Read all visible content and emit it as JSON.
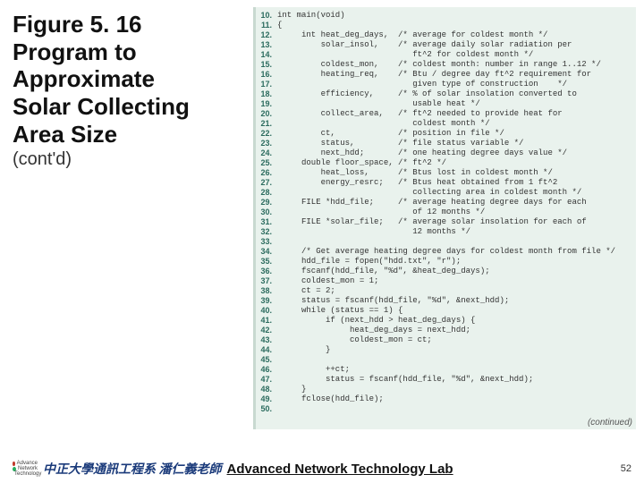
{
  "title": "Figure 5. 16\nProgram to\nApproximate\nSolar Collecting\nArea Size",
  "subtitle": "(cont'd)",
  "continued": "(continued)",
  "footer": {
    "icon_lines": [
      "Advance",
      "Network",
      "Technology"
    ],
    "cn": "中正大學通訊工程系 潘仁義老師",
    "lab": "Advanced Network Technology Lab",
    "page": "52"
  },
  "code": [
    {
      "n": "10.",
      "t": "int main(void)"
    },
    {
      "n": "11.",
      "t": "{"
    },
    {
      "n": "12.",
      "t": "     int heat_deg_days,  /* average for coldest month */"
    },
    {
      "n": "13.",
      "t": "         solar_insol,    /* average daily solar radiation per"
    },
    {
      "n": "14.",
      "t": "                            ft^2 for coldest month */"
    },
    {
      "n": "15.",
      "t": "         coldest_mon,    /* coldest month: number in range 1..12 */"
    },
    {
      "n": "16.",
      "t": "         heating_req,    /* Btu / degree day ft^2 requirement for"
    },
    {
      "n": "17.",
      "t": "                            given type of construction    */"
    },
    {
      "n": "18.",
      "t": "         efficiency,     /* % of solar insolation converted to"
    },
    {
      "n": "19.",
      "t": "                            usable heat */"
    },
    {
      "n": "20.",
      "t": "         collect_area,   /* ft^2 needed to provide heat for"
    },
    {
      "n": "21.",
      "t": "                            coldest month */"
    },
    {
      "n": "22.",
      "t": "         ct,             /* position in file */"
    },
    {
      "n": "23.",
      "t": "         status,         /* file status variable */"
    },
    {
      "n": "24.",
      "t": "         next_hdd;       /* one heating degree days value */"
    },
    {
      "n": "25.",
      "t": "     double floor_space, /* ft^2 */"
    },
    {
      "n": "26.",
      "t": "         heat_loss,      /* Btus lost in coldest month */"
    },
    {
      "n": "27.",
      "t": "         energy_resrc;   /* Btus heat obtained from 1 ft^2"
    },
    {
      "n": "28.",
      "t": "                            collecting area in coldest month */"
    },
    {
      "n": "29.",
      "t": "     FILE *hdd_file;     /* average heating degree days for each"
    },
    {
      "n": "30.",
      "t": "                            of 12 months */"
    },
    {
      "n": "31.",
      "t": "     FILE *solar_file;   /* average solar insolation for each of"
    },
    {
      "n": "32.",
      "t": "                            12 months */"
    },
    {
      "n": "33.",
      "t": ""
    },
    {
      "n": "34.",
      "t": "     /* Get average heating degree days for coldest month from file */"
    },
    {
      "n": "35.",
      "t": "     hdd_file = fopen(\"hdd.txt\", \"r\");"
    },
    {
      "n": "36.",
      "t": "     fscanf(hdd_file, \"%d\", &heat_deg_days);"
    },
    {
      "n": "37.",
      "t": "     coldest_mon = 1;"
    },
    {
      "n": "38.",
      "t": "     ct = 2;"
    },
    {
      "n": "39.",
      "t": "     status = fscanf(hdd_file, \"%d\", &next_hdd);"
    },
    {
      "n": "40.",
      "t": "     while (status == 1) {"
    },
    {
      "n": "41.",
      "t": "          if (next_hdd > heat_deg_days) {"
    },
    {
      "n": "42.",
      "t": "               heat_deg_days = next_hdd;"
    },
    {
      "n": "43.",
      "t": "               coldest_mon = ct;"
    },
    {
      "n": "44.",
      "t": "          }"
    },
    {
      "n": "45.",
      "t": ""
    },
    {
      "n": "46.",
      "t": "          ++ct;"
    },
    {
      "n": "47.",
      "t": "          status = fscanf(hdd_file, \"%d\", &next_hdd);"
    },
    {
      "n": "48.",
      "t": "     }"
    },
    {
      "n": "49.",
      "t": "     fclose(hdd_file);"
    },
    {
      "n": "50.",
      "t": ""
    }
  ]
}
